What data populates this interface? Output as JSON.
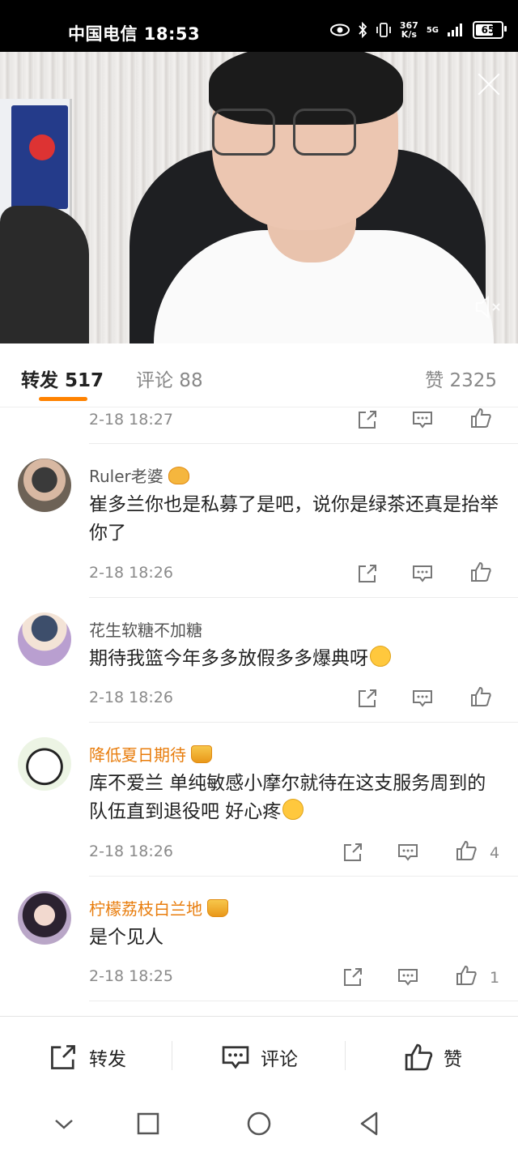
{
  "status_bar": {
    "carrier_time": "中国电信 18:53",
    "speed_value": "367",
    "speed_unit": "K/s",
    "network": "5G",
    "battery": "65"
  },
  "tabs": {
    "repost": "转发 517",
    "comment": "评论 88",
    "like": "赞 2325"
  },
  "comments": [
    {
      "time": "2-18 18:27"
    },
    {
      "name": "Ruler老婆",
      "text": "崔多兰你也是私募了是吧，说你是绿茶还真是抬举你了",
      "time": "2-18 18:26"
    },
    {
      "name": "花生软糖不加糖",
      "text": "期待我篮今年多多放假多多爆典呀",
      "time": "2-18 18:26"
    },
    {
      "name": "降低夏日期待",
      "text": "库不爱兰 单纯敏感小摩尔就待在这支服务周到的队伍直到退役吧 好心疼",
      "time": "2-18 18:26",
      "likes": "4"
    },
    {
      "name": "柠檬荔枝白兰地",
      "text": "是个见人",
      "time": "2-18 18:25",
      "likes": "1"
    }
  ],
  "bottom_bar": {
    "repost": "转发",
    "comment": "评论",
    "like": "赞"
  },
  "icons": {
    "share": "share-icon",
    "comment": "comment-icon",
    "like": "thumbs-up-icon",
    "close": "close-icon",
    "mute": "mute-icon"
  },
  "colors": {
    "accent": "#ff8200",
    "vip_name": "#e87d0d"
  }
}
